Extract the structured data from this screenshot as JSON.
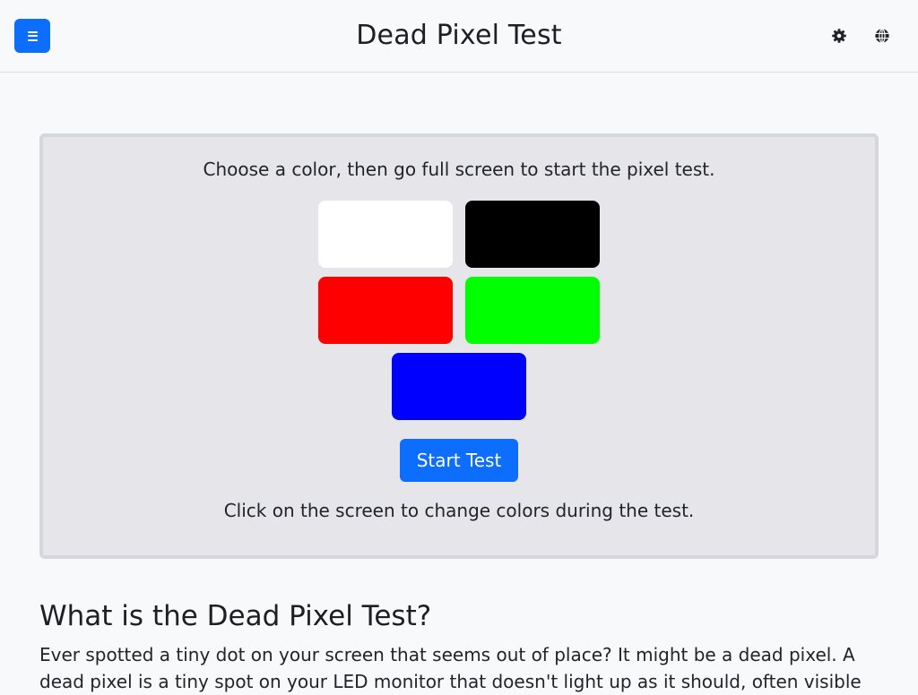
{
  "header": {
    "title": "Dead Pixel Test",
    "menu_icon": "hamburger-menu-icon",
    "theme_icon": "gear-icon",
    "language_icon": "globe-icon",
    "accent_color": "#0d6efd"
  },
  "test_panel": {
    "intro": "Choose a color, then go full screen to start the pixel test.",
    "swatches": [
      {
        "name": "white",
        "color": "#ffffff"
      },
      {
        "name": "black",
        "color": "#000000"
      },
      {
        "name": "red",
        "color": "#ff0000"
      },
      {
        "name": "green",
        "color": "#00ff00"
      },
      {
        "name": "blue",
        "color": "#0000ff"
      }
    ],
    "start_button": "Start Test",
    "hint": "Click on the screen to change colors during the test."
  },
  "content": {
    "heading": "What is the Dead Pixel Test?",
    "paragraph": "Ever spotted a tiny dot on your screen that seems out of place? It might be a dead pixel. A dead pixel is a tiny spot on your LED monitor that doesn't light up as it should, often visible"
  }
}
